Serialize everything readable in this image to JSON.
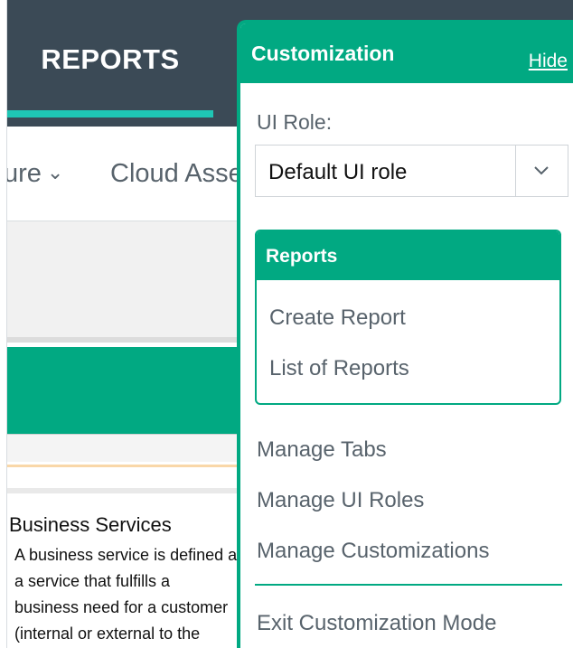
{
  "header": {
    "active_tab": "REPORTS"
  },
  "nav": {
    "items": [
      {
        "label": "ure",
        "has_dropdown": true
      },
      {
        "label": "Cloud Assets",
        "has_dropdown": false
      }
    ]
  },
  "content": {
    "section_title": "Business Services",
    "description_lines": [
      "A business service is defined as",
      "a service that fulfills a",
      "business need for a customer",
      "(internal or external to the"
    ]
  },
  "panel": {
    "title": "Customization",
    "hide_label": "Hide",
    "ui_role_label": "UI Role:",
    "ui_role_value": "Default UI role",
    "reports_group": {
      "title": "Reports",
      "items": [
        "Create Report",
        "List of Reports"
      ]
    },
    "links": [
      "Manage Tabs",
      "Manage UI Roles",
      "Manage Customizations"
    ],
    "exit_label": "Exit Customization Mode"
  },
  "colors": {
    "accent_green": "#01a982",
    "header_dark": "#3b4a56",
    "tab_underline": "#1fc6b4",
    "text_gray": "#58636c"
  },
  "icons": {
    "dropdown": "chevron-down-icon"
  }
}
